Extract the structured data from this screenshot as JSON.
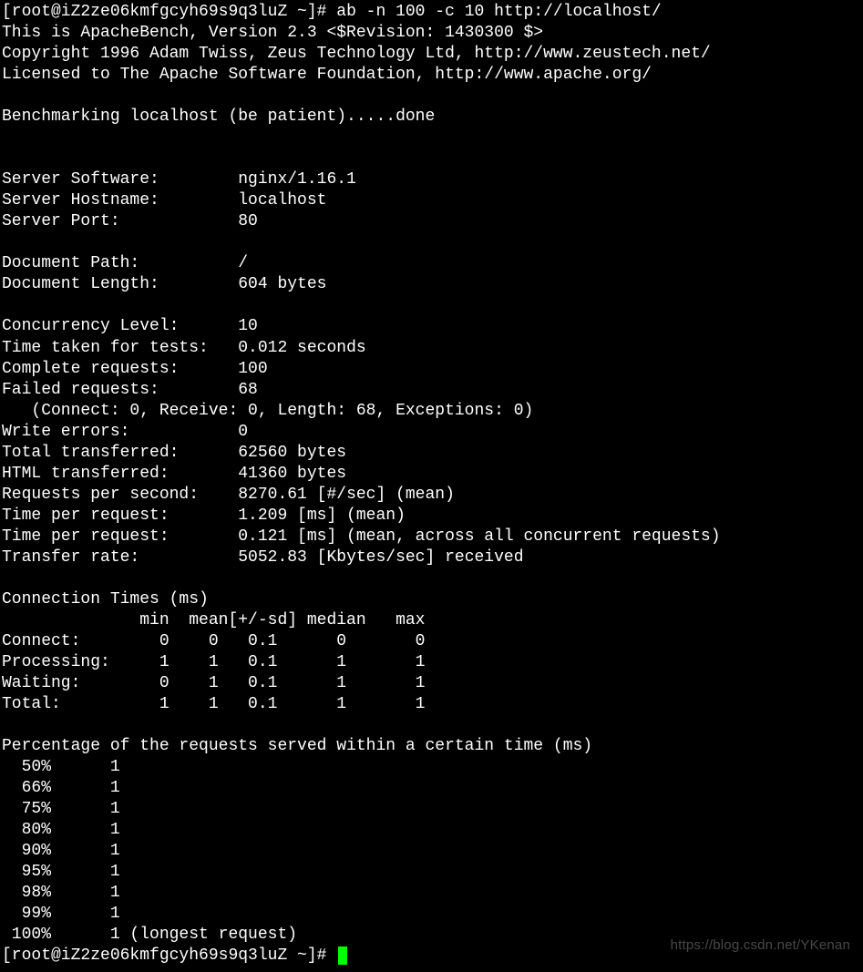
{
  "prompt1": "[root@iZ2ze06kmfgcyh69s9q3luZ ~]# ",
  "command": "ab -n 100 -c 10 http://localhost/",
  "header": {
    "line1": "This is ApacheBench, Version 2.3 <$Revision: 1430300 $>",
    "line2": "Copyright 1996 Adam Twiss, Zeus Technology Ltd, http://www.zeustech.net/",
    "line3": "Licensed to The Apache Software Foundation, http://www.apache.org/",
    "bench": "Benchmarking localhost (be patient).....done"
  },
  "kv": {
    "server_software_label": "Server Software:        ",
    "server_software_value": "nginx/1.16.1",
    "server_hostname_label": "Server Hostname:        ",
    "server_hostname_value": "localhost",
    "server_port_label": "Server Port:            ",
    "server_port_value": "80",
    "doc_path_label": "Document Path:          ",
    "doc_path_value": "/",
    "doc_length_label": "Document Length:        ",
    "doc_length_value": "604 bytes",
    "concurrency_label": "Concurrency Level:      ",
    "concurrency_value": "10",
    "time_taken_label": "Time taken for tests:   ",
    "time_taken_value": "0.012 seconds",
    "complete_label": "Complete requests:      ",
    "complete_value": "100",
    "failed_label": "Failed requests:        ",
    "failed_value": "68",
    "failed_detail": "   (Connect: 0, Receive: 0, Length: 68, Exceptions: 0)",
    "write_errors_label": "Write errors:           ",
    "write_errors_value": "0",
    "total_trans_label": "Total transferred:      ",
    "total_trans_value": "62560 bytes",
    "html_trans_label": "HTML transferred:       ",
    "html_trans_value": "41360 bytes",
    "rps_label": "Requests per second:    ",
    "rps_value": "8270.61 [#/sec] (mean)",
    "tpr1_label": "Time per request:       ",
    "tpr1_value": "1.209 [ms] (mean)",
    "tpr2_label": "Time per request:       ",
    "tpr2_value": "0.121 [ms] (mean, across all concurrent requests)",
    "transfer_rate_label": "Transfer rate:          ",
    "transfer_rate_value": "5052.83 [Kbytes/sec] received"
  },
  "conn": {
    "title": "Connection Times (ms)",
    "header": "              min  mean[+/-sd] median   max",
    "connect": "Connect:        0    0   0.1      0       0",
    "process": "Processing:     1    1   0.1      1       1",
    "waiting": "Waiting:        0    1   0.1      1       1",
    "total": "Total:          1    1   0.1      1       1"
  },
  "pct": {
    "title": "Percentage of the requests served within a certain time (ms)",
    "p50": "  50%      1",
    "p66": "  66%      1",
    "p75": "  75%      1",
    "p80": "  80%      1",
    "p90": "  90%      1",
    "p95": "  95%      1",
    "p98": "  98%      1",
    "p99": "  99%      1",
    "p100": " 100%      1 (longest request)"
  },
  "prompt2": "[root@iZ2ze06kmfgcyh69s9q3luZ ~]# ",
  "watermark": "https://blog.csdn.net/YKenan"
}
